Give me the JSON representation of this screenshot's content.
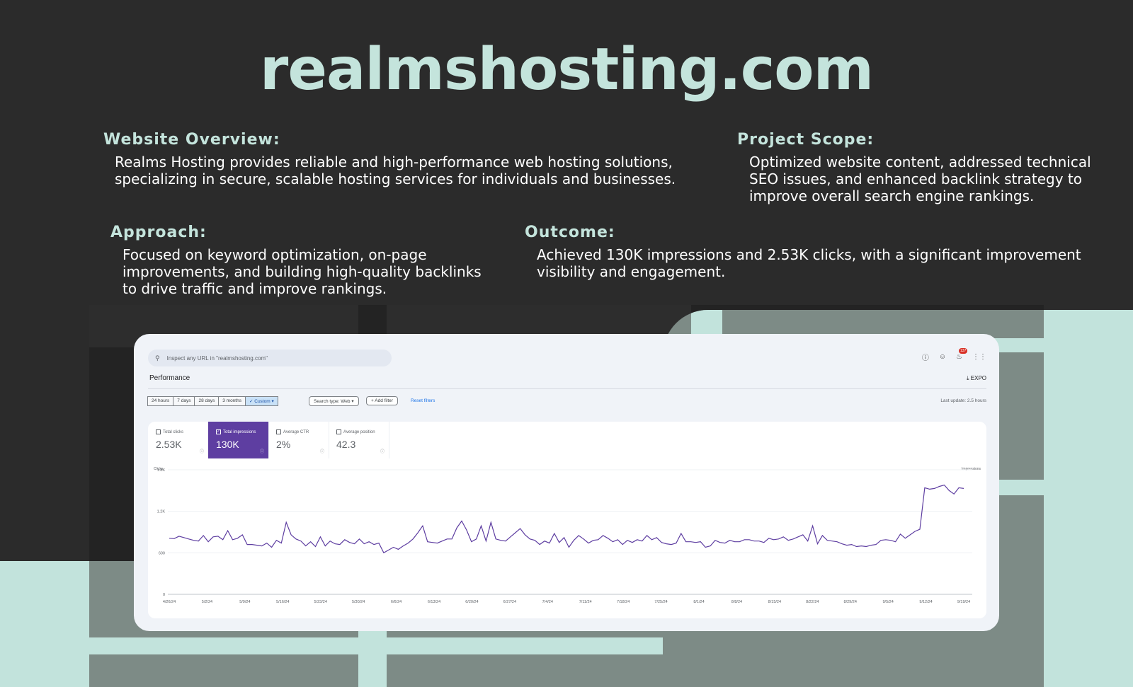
{
  "title": "realmshosting.com",
  "sections": {
    "overview": {
      "heading": "Website Overview:",
      "text": "Realms Hosting provides reliable and high-performance web hosting solutions,\nspecializing in secure, scalable hosting services for individuals and businesses."
    },
    "scope": {
      "heading": "Project Scope:",
      "text": "Optimized website content, addressed technical\n SEO issues, and enhanced backlink strategy to\nimprove overall search engine rankings."
    },
    "approach": {
      "heading": "Approach:",
      "text": "Focused on keyword optimization, on-page\nimprovements, and building high-quality backlinks\nto drive traffic and improve rankings."
    },
    "outcome": {
      "heading": "Outcome:",
      "text": "Achieved 130K impressions and 2.53K clicks, with a significant improvement\nvisibility and engagement."
    }
  },
  "dashboard": {
    "search_placeholder": "Inspect any URL in \"realmshosting.com\"",
    "notification_count": "137",
    "page_title": "Performance",
    "export_label": "EXPO",
    "date_options": [
      "24 hours",
      "7 days",
      "28 days",
      "3 months",
      "Custom"
    ],
    "selected_date": "Custom",
    "search_type": "Search type: Web",
    "add_filter": "Add filter",
    "reset_filters": "Reset filters",
    "last_update": "Last update: 2.5 hours",
    "metrics": [
      {
        "label": "Total clicks",
        "value": "2.53K",
        "checked": false
      },
      {
        "label": "Total impressions",
        "value": "130K",
        "checked": true
      },
      {
        "label": "Average CTR",
        "value": "2%",
        "checked": false
      },
      {
        "label": "Average position",
        "value": "42.3",
        "checked": false
      }
    ]
  },
  "chart_data": {
    "type": "line",
    "left_axis_title": "Clicks",
    "right_axis_title": "Impressions",
    "yticks": [
      "0",
      "600",
      "1.2K",
      "1.8K"
    ],
    "ylim": [
      0,
      1800
    ],
    "series_color": "#5e3ea1",
    "x_tick_labels": [
      "4/26/24",
      "5/2/24",
      "5/9/24",
      "5/16/24",
      "5/23/24",
      "5/30/24",
      "6/6/24",
      "6/13/24",
      "6/20/24",
      "6/27/24",
      "7/4/24",
      "7/11/24",
      "7/18/24",
      "7/25/24",
      "8/1/24",
      "8/8/24",
      "8/15/24",
      "8/22/24",
      "8/29/24",
      "9/5/24",
      "9/12/24",
      "9/19/24"
    ],
    "values": [
      810,
      805,
      840,
      820,
      800,
      780,
      770,
      850,
      760,
      830,
      840,
      790,
      920,
      790,
      810,
      860,
      720,
      720,
      710,
      700,
      740,
      680,
      780,
      740,
      1040,
      860,
      800,
      770,
      700,
      760,
      690,
      830,
      700,
      770,
      730,
      720,
      790,
      750,
      730,
      800,
      730,
      760,
      720,
      740,
      600,
      640,
      680,
      650,
      700,
      740,
      800,
      890,
      990,
      760,
      750,
      740,
      770,
      800,
      800,
      960,
      1060,
      930,
      760,
      800,
      990,
      770,
      1040,
      800,
      780,
      770,
      830,
      890,
      950,
      860,
      800,
      780,
      720,
      770,
      740,
      880,
      750,
      820,
      680,
      780,
      850,
      800,
      740,
      780,
      790,
      850,
      810,
      760,
      790,
      720,
      780,
      750,
      790,
      770,
      850,
      790,
      820,
      750,
      730,
      720,
      740,
      880,
      760,
      760,
      750,
      760,
      680,
      700,
      780,
      750,
      740,
      780,
      760,
      760,
      790,
      790,
      770,
      770,
      750,
      810,
      790,
      800,
      830,
      780,
      800,
      830,
      860,
      770,
      990,
      730,
      850,
      780,
      770,
      760,
      730,
      710,
      720,
      690,
      700,
      690,
      710,
      720,
      780,
      790,
      780,
      760,
      870,
      810,
      860,
      910,
      940,
      1540,
      1520,
      1530,
      1560,
      1580,
      1500,
      1450,
      1540,
      1530
    ],
    "grid": true,
    "legend": "none"
  }
}
